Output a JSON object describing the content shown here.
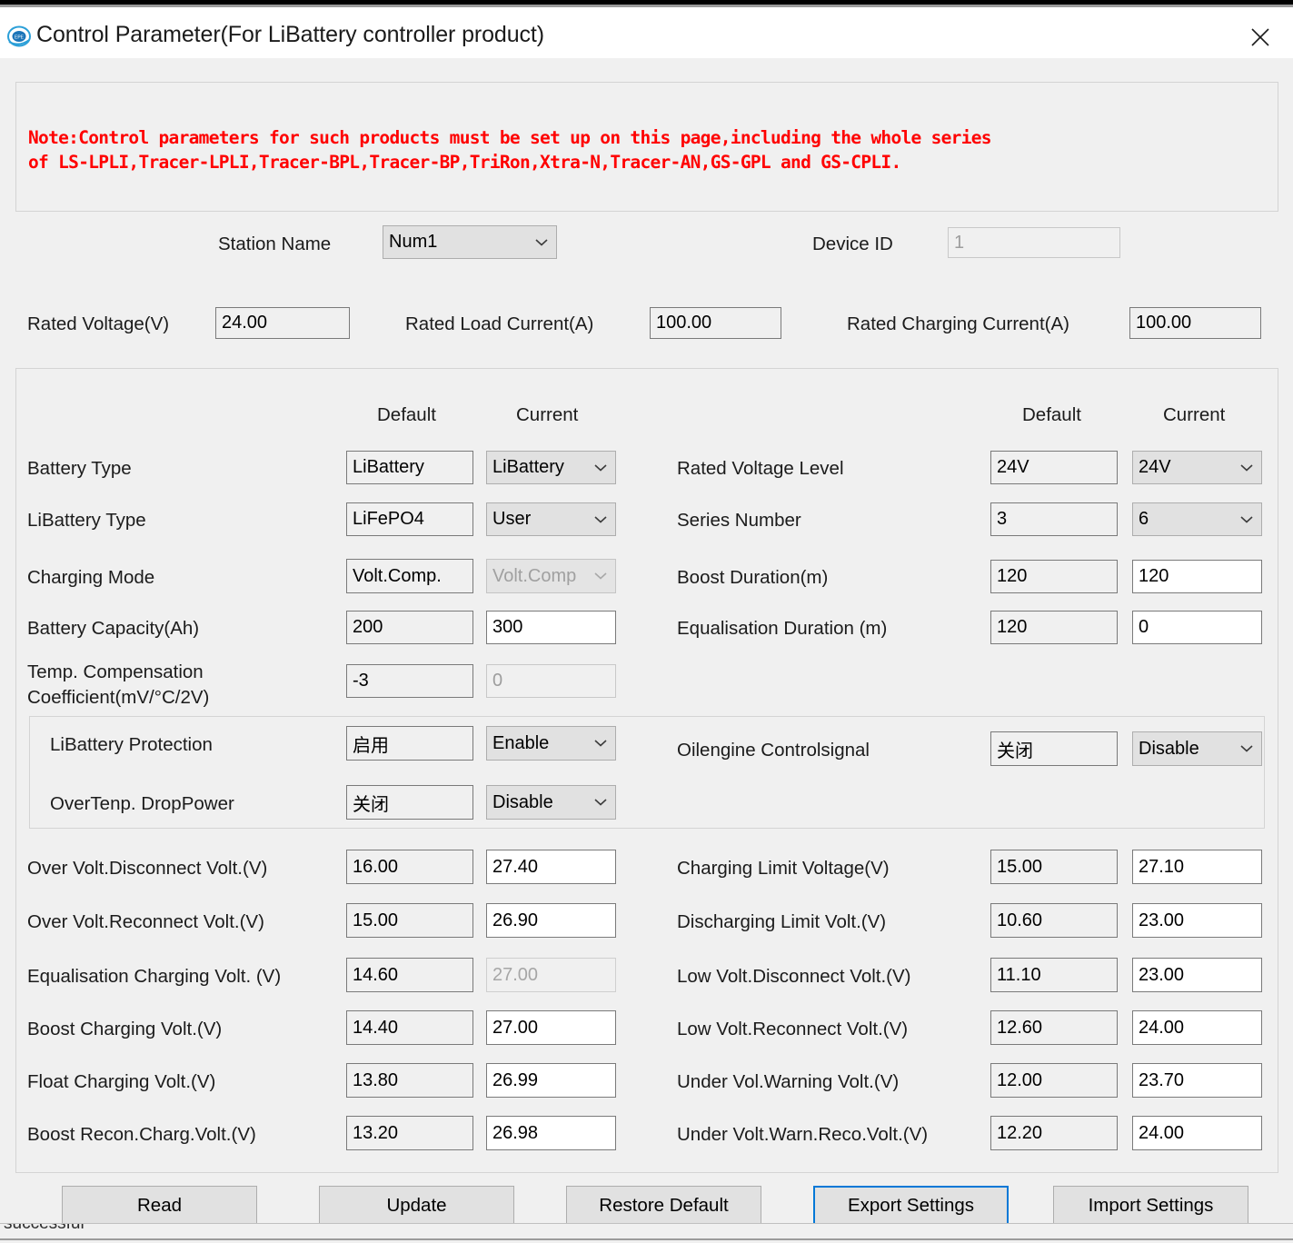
{
  "window": {
    "title": "Control Parameter(For LiBattery controller product)",
    "app_icon": "epever-logo-icon",
    "close_label": "×"
  },
  "note": {
    "text": "Note:Control parameters for such products must be set up on this page,including the whole series\nof LS-LPLI,Tracer-LPLI,Tracer-BPL,Tracer-BP,TriRon,Xtra-N,Tracer-AN,GS-GPL and GS-CPLI.",
    "color": "#ff0000"
  },
  "header": {
    "station_name_label": "Station Name",
    "station_name_value": "Num1",
    "device_id_label": "Device ID",
    "device_id_value": "1",
    "rated_voltage_label": "Rated Voltage(V)",
    "rated_voltage_value": "24.00",
    "rated_load_current_label": "Rated Load Current(A)",
    "rated_load_current_value": "100.00",
    "rated_charging_current_label": "Rated Charging Current(A)",
    "rated_charging_current_value": "100.00"
  },
  "columns": {
    "default": "Default",
    "current": "Current"
  },
  "left_rows": [
    {
      "label": "Battery Type",
      "default": "LiBattery",
      "current": "LiBattery",
      "type": "combo",
      "disabled": false
    },
    {
      "label": "LiBattery Type",
      "default": "LiFePO4",
      "current": "User",
      "type": "combo",
      "disabled": false
    },
    {
      "label": "Charging Mode",
      "default": "Volt.Comp.",
      "current": "Volt.Comp",
      "type": "combo",
      "disabled": true
    },
    {
      "label": "Battery Capacity(Ah)",
      "default": "200",
      "current": "300",
      "type": "text",
      "disabled": false
    },
    {
      "label": "Temp. Compensation\nCoefficient(mV/°C/2V)",
      "default": "-3",
      "current": "0",
      "type": "text",
      "disabled": true
    }
  ],
  "right_rows": [
    {
      "label": "Rated Voltage Level",
      "default": "24V",
      "current": "24V",
      "type": "combo",
      "disabled": false
    },
    {
      "label": "Series Number",
      "default": "3",
      "current": "6",
      "type": "combo",
      "disabled": false
    },
    {
      "label": "Boost Duration(m)",
      "default": "120",
      "current": "120",
      "type": "text",
      "disabled": false
    },
    {
      "label": "Equalisation Duration (m)",
      "default": "120",
      "current": "0",
      "type": "text",
      "disabled": false
    }
  ],
  "protection_rows_left": [
    {
      "label": "LiBattery Protection",
      "default": "启用",
      "current": "Enable",
      "type": "combo",
      "disabled": false
    },
    {
      "label": "OverTenp. DropPower",
      "default": "关闭",
      "current": "Disable",
      "type": "combo",
      "disabled": false
    }
  ],
  "protection_rows_right": [
    {
      "label": "Oilengine Controlsignal",
      "default": "关闭",
      "current": "Disable",
      "type": "combo",
      "disabled": false
    }
  ],
  "volt_rows_left": [
    {
      "label": "Over Volt.Disconnect Volt.(V)",
      "default": "16.00",
      "current": "27.40",
      "disabled": false
    },
    {
      "label": "Over Volt.Reconnect Volt.(V)",
      "default": "15.00",
      "current": "26.90",
      "disabled": false
    },
    {
      "label": "Equalisation Charging Volt. (V)",
      "default": "14.60",
      "current": "27.00",
      "disabled": true
    },
    {
      "label": "Boost Charging Volt.(V)",
      "default": "14.40",
      "current": "27.00",
      "disabled": false
    },
    {
      "label": "Float Charging Volt.(V)",
      "default": "13.80",
      "current": "26.99",
      "disabled": false
    },
    {
      "label": "Boost Recon.Charg.Volt.(V)",
      "default": "13.20",
      "current": "26.98",
      "disabled": false
    }
  ],
  "volt_rows_right": [
    {
      "label": "Charging Limit Voltage(V)",
      "default": "15.00",
      "current": "27.10",
      "disabled": false
    },
    {
      "label": "Discharging Limit Volt.(V)",
      "default": "10.60",
      "current": "23.00",
      "disabled": false
    },
    {
      "label": "Low Volt.Disconnect Volt.(V)",
      "default": "11.10",
      "current": "23.00",
      "disabled": false
    },
    {
      "label": "Low Volt.Reconnect Volt.(V)",
      "default": "12.60",
      "current": "24.00",
      "disabled": false
    },
    {
      "label": "Under Vol.Warning Volt.(V)",
      "default": "12.00",
      "current": "23.70",
      "disabled": false
    },
    {
      "label": "Under Volt.Warn.Reco.Volt.(V)",
      "default": "12.20",
      "current": "24.00",
      "disabled": false
    }
  ],
  "buttons": [
    {
      "label": "Read",
      "focused": false
    },
    {
      "label": "Update",
      "focused": false
    },
    {
      "label": "Restore Default",
      "focused": false
    },
    {
      "label": "Export Settings",
      "focused": true
    },
    {
      "label": "Import Settings",
      "focused": false
    }
  ],
  "statusbar": {
    "text": "successful"
  },
  "colors": {
    "accent": "#0078d7",
    "note": "#ff0000",
    "window_bg": "#f0f0f0"
  }
}
